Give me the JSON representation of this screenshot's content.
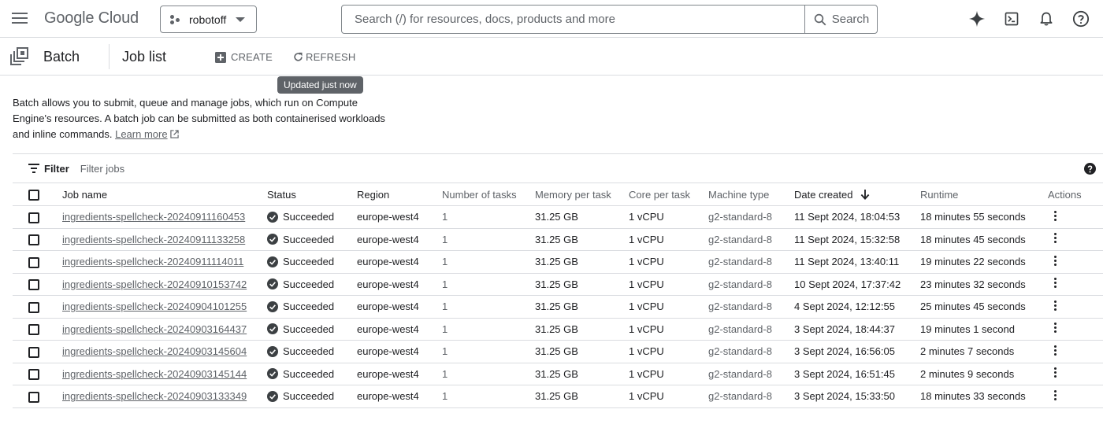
{
  "header": {
    "logo_google": "Google",
    "logo_cloud": "Cloud",
    "project": "robotoff",
    "search_placeholder": "Search (/) for resources, docs, products and more",
    "search_button": "Search"
  },
  "subheader": {
    "service": "Batch",
    "page": "Job list",
    "create": "CREATE",
    "refresh": "REFRESH",
    "tooltip": "Updated just now"
  },
  "description": {
    "text": "Batch allows you to submit, queue and manage jobs, which run on Compute Engine's resources. A batch job can be submitted as both containerised workloads and inline commands.",
    "link": "Learn more"
  },
  "filter": {
    "label": "Filter",
    "placeholder": "Filter jobs"
  },
  "table": {
    "columns": [
      "Job name",
      "Status",
      "Region",
      "Number of tasks",
      "Memory per task",
      "Core per task",
      "Machine type",
      "Date created",
      "Runtime",
      "Actions"
    ],
    "rows": [
      {
        "job": "ingredients-spellcheck-20240911160453",
        "status": "Succeeded",
        "region": "europe-west4",
        "tasks": "1",
        "memory": "31.25 GB",
        "core": "1 vCPU",
        "machine": "g2-standard-8",
        "created": "11 Sept 2024, 18:04:53",
        "runtime": "18 minutes 55 seconds"
      },
      {
        "job": "ingredients-spellcheck-20240911133258",
        "status": "Succeeded",
        "region": "europe-west4",
        "tasks": "1",
        "memory": "31.25 GB",
        "core": "1 vCPU",
        "machine": "g2-standard-8",
        "created": "11 Sept 2024, 15:32:58",
        "runtime": "18 minutes 45 seconds"
      },
      {
        "job": "ingredients-spellcheck-20240911114011",
        "status": "Succeeded",
        "region": "europe-west4",
        "tasks": "1",
        "memory": "31.25 GB",
        "core": "1 vCPU",
        "machine": "g2-standard-8",
        "created": "11 Sept 2024, 13:40:11",
        "runtime": "19 minutes 22 seconds"
      },
      {
        "job": "ingredients-spellcheck-20240910153742",
        "status": "Succeeded",
        "region": "europe-west4",
        "tasks": "1",
        "memory": "31.25 GB",
        "core": "1 vCPU",
        "machine": "g2-standard-8",
        "created": "10 Sept 2024, 17:37:42",
        "runtime": "23 minutes 32 seconds"
      },
      {
        "job": "ingredients-spellcheck-20240904101255",
        "status": "Succeeded",
        "region": "europe-west4",
        "tasks": "1",
        "memory": "31.25 GB",
        "core": "1 vCPU",
        "machine": "g2-standard-8",
        "created": "4 Sept 2024, 12:12:55",
        "runtime": "25 minutes 45 seconds"
      },
      {
        "job": "ingredients-spellcheck-20240903164437",
        "status": "Succeeded",
        "region": "europe-west4",
        "tasks": "1",
        "memory": "31.25 GB",
        "core": "1 vCPU",
        "machine": "g2-standard-8",
        "created": "3 Sept 2024, 18:44:37",
        "runtime": "19 minutes 1 second"
      },
      {
        "job": "ingredients-spellcheck-20240903145604",
        "status": "Succeeded",
        "region": "europe-west4",
        "tasks": "1",
        "memory": "31.25 GB",
        "core": "1 vCPU",
        "machine": "g2-standard-8",
        "created": "3 Sept 2024, 16:56:05",
        "runtime": "2 minutes 7 seconds"
      },
      {
        "job": "ingredients-spellcheck-20240903145144",
        "status": "Succeeded",
        "region": "europe-west4",
        "tasks": "1",
        "memory": "31.25 GB",
        "core": "1 vCPU",
        "machine": "g2-standard-8",
        "created": "3 Sept 2024, 16:51:45",
        "runtime": "2 minutes 9 seconds"
      },
      {
        "job": "ingredients-spellcheck-20240903133349",
        "status": "Succeeded",
        "region": "europe-west4",
        "tasks": "1",
        "memory": "31.25 GB",
        "core": "1 vCPU",
        "machine": "g2-standard-8",
        "created": "3 Sept 2024, 15:33:50",
        "runtime": "18 minutes 33 seconds"
      }
    ]
  },
  "colors": {
    "success": "#3c4043",
    "accent": "#1a73e8",
    "border": "#dadce0"
  }
}
